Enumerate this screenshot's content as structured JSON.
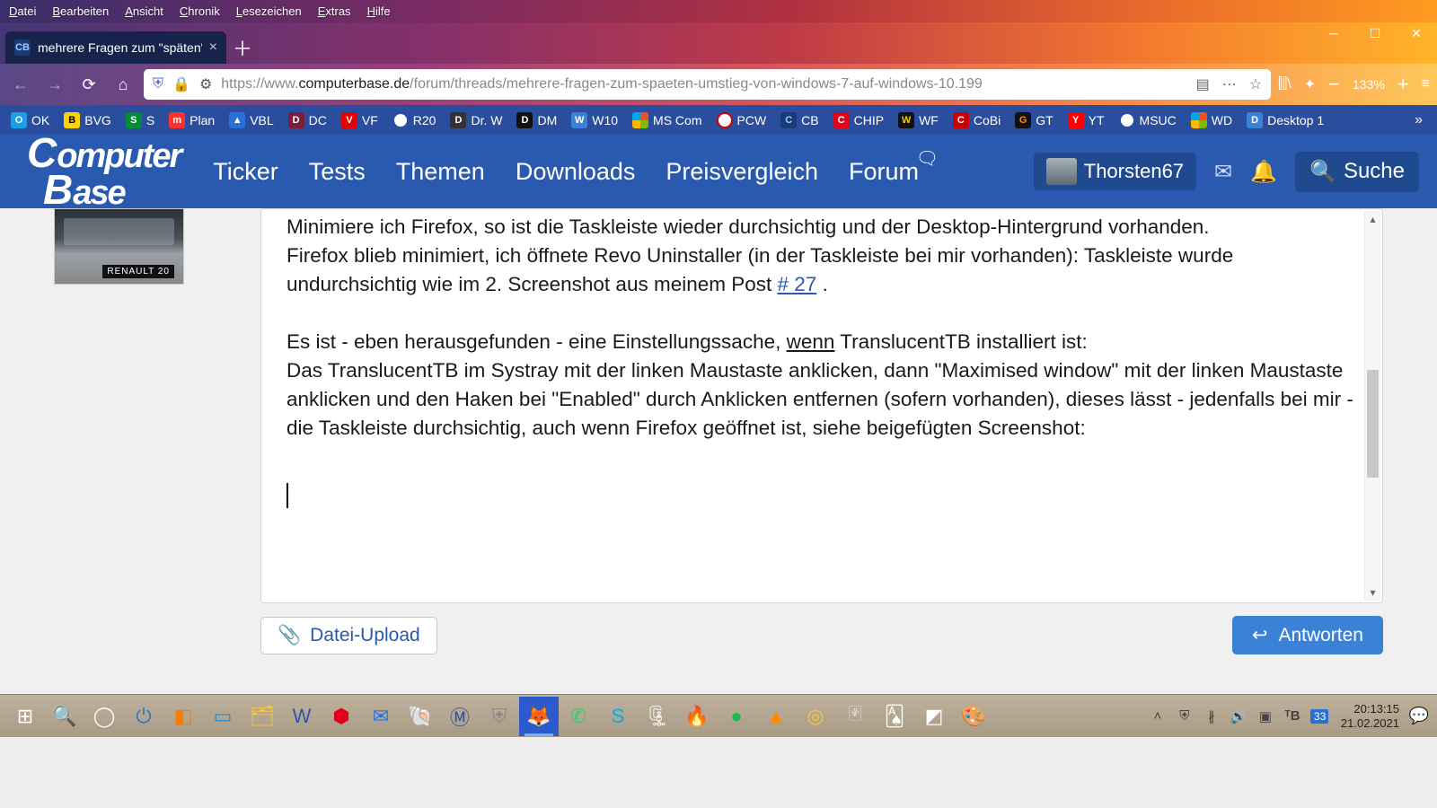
{
  "ff_menu": [
    "Datei",
    "Bearbeiten",
    "Ansicht",
    "Chronik",
    "Lesezeichen",
    "Extras",
    "Hilfe"
  ],
  "ff_menu_accel": [
    "D",
    "B",
    "A",
    "C",
    "L",
    "E",
    "H"
  ],
  "tab": {
    "title": "mehrere Fragen zum \"späten\" U",
    "favicon": "CB"
  },
  "url": {
    "scheme": "https://www.",
    "host": "computerbase.de",
    "path": "/forum/threads/mehrere-fragen-zum-spaeten-umstieg-von-windows-7-auf-windows-10.199"
  },
  "zoom": "133%",
  "bookmarks": [
    {
      "label": "OK",
      "bg": "#1aa0e8",
      "fg": "#fff"
    },
    {
      "label": "BVG",
      "bg": "#ffd400",
      "fg": "#000"
    },
    {
      "label": "S",
      "bg": "#008d36",
      "fg": "#fff"
    },
    {
      "label": "Plan",
      "bg": "#ff3030",
      "fg": "#fff",
      "icon": "m"
    },
    {
      "label": "VBL",
      "bg": "#2a6fd6",
      "fg": "#fff",
      "tri": true
    },
    {
      "label": "DC",
      "bg": "#7a1f3a",
      "fg": "#fff"
    },
    {
      "label": "VF",
      "bg": "#e60000",
      "fg": "#fff"
    },
    {
      "label": "R20",
      "bg": "#fff",
      "fg": "#2a4d9e",
      "ring": true
    },
    {
      "label": "Dr. W",
      "bg": "#333",
      "fg": "#fff"
    },
    {
      "label": "DM",
      "bg": "#111",
      "fg": "#fff"
    },
    {
      "label": "W10",
      "bg": "#3b82d6",
      "fg": "#fff"
    },
    {
      "label": "MS Com",
      "bg": "",
      "ms": true
    },
    {
      "label": "PCW",
      "bg": "#fff",
      "fg": "#c00",
      "ring": true
    },
    {
      "label": "CB",
      "bg": "#1a3a7a",
      "fg": "#9fcaff"
    },
    {
      "label": "CHIP",
      "bg": "#e2001a",
      "fg": "#fff"
    },
    {
      "label": "WF",
      "bg": "#111",
      "fg": "#f7c600"
    },
    {
      "label": "CoBi",
      "bg": "#c00",
      "fg": "#fff"
    },
    {
      "label": "GT",
      "bg": "#111",
      "fg": "#ff8c00"
    },
    {
      "label": "YT",
      "bg": "#f00",
      "fg": "#fff"
    },
    {
      "label": "MSUC",
      "bg": "#fff",
      "fg": "#2a4d9e",
      "ring": true
    },
    {
      "label": "WD",
      "bg": "",
      "ms": true
    },
    {
      "label": "Desktop 1",
      "bg": "#3b82d6",
      "fg": "#fff"
    }
  ],
  "cb_nav": [
    "Ticker",
    "Tests",
    "Themen",
    "Downloads",
    "Preisvergleich",
    "Forum"
  ],
  "cb_user": "Thorsten67",
  "cb_search": "Suche",
  "avatar_plate": "RENAULT 20",
  "post": {
    "p1": "Minimiere ich Firefox, so ist die Taskleiste wieder durchsichtig und der Desktop-Hintergrund vorhanden.",
    "p2a": "Firefox blieb minimiert, ich öffnete Revo Uninstaller (in der Taskleiste bei mir vorhanden): Taskleiste wurde undurchsichtig wie im 2. Screenshot aus meinem Post ",
    "link27": "# 27",
    "p2b": " .",
    "p3a": "Es ist - eben herausgefunden - eine Einstellungssache, ",
    "p3u": "wenn",
    "p3b": " TranslucentTB installiert ist:",
    "p4": "Das TranslucentTB im Systray mit der linken Maustaste anklicken, dann \"Maximised window\" mit der linken Maustaste anklicken und den Haken bei \"Enabled\" durch Anklicken entfernen (sofern vorhanden), dieses lässt - jedenfalls bei mir - die Taskleiste durchsichtig, auch wenn Firefox geöffnet ist, siehe beigefügten Screenshot:"
  },
  "upload_label": "Datei-Upload",
  "reply_label": "Antworten",
  "systray_badge": "33",
  "clock_time": "20:13:15",
  "clock_date": "21.02.2021"
}
